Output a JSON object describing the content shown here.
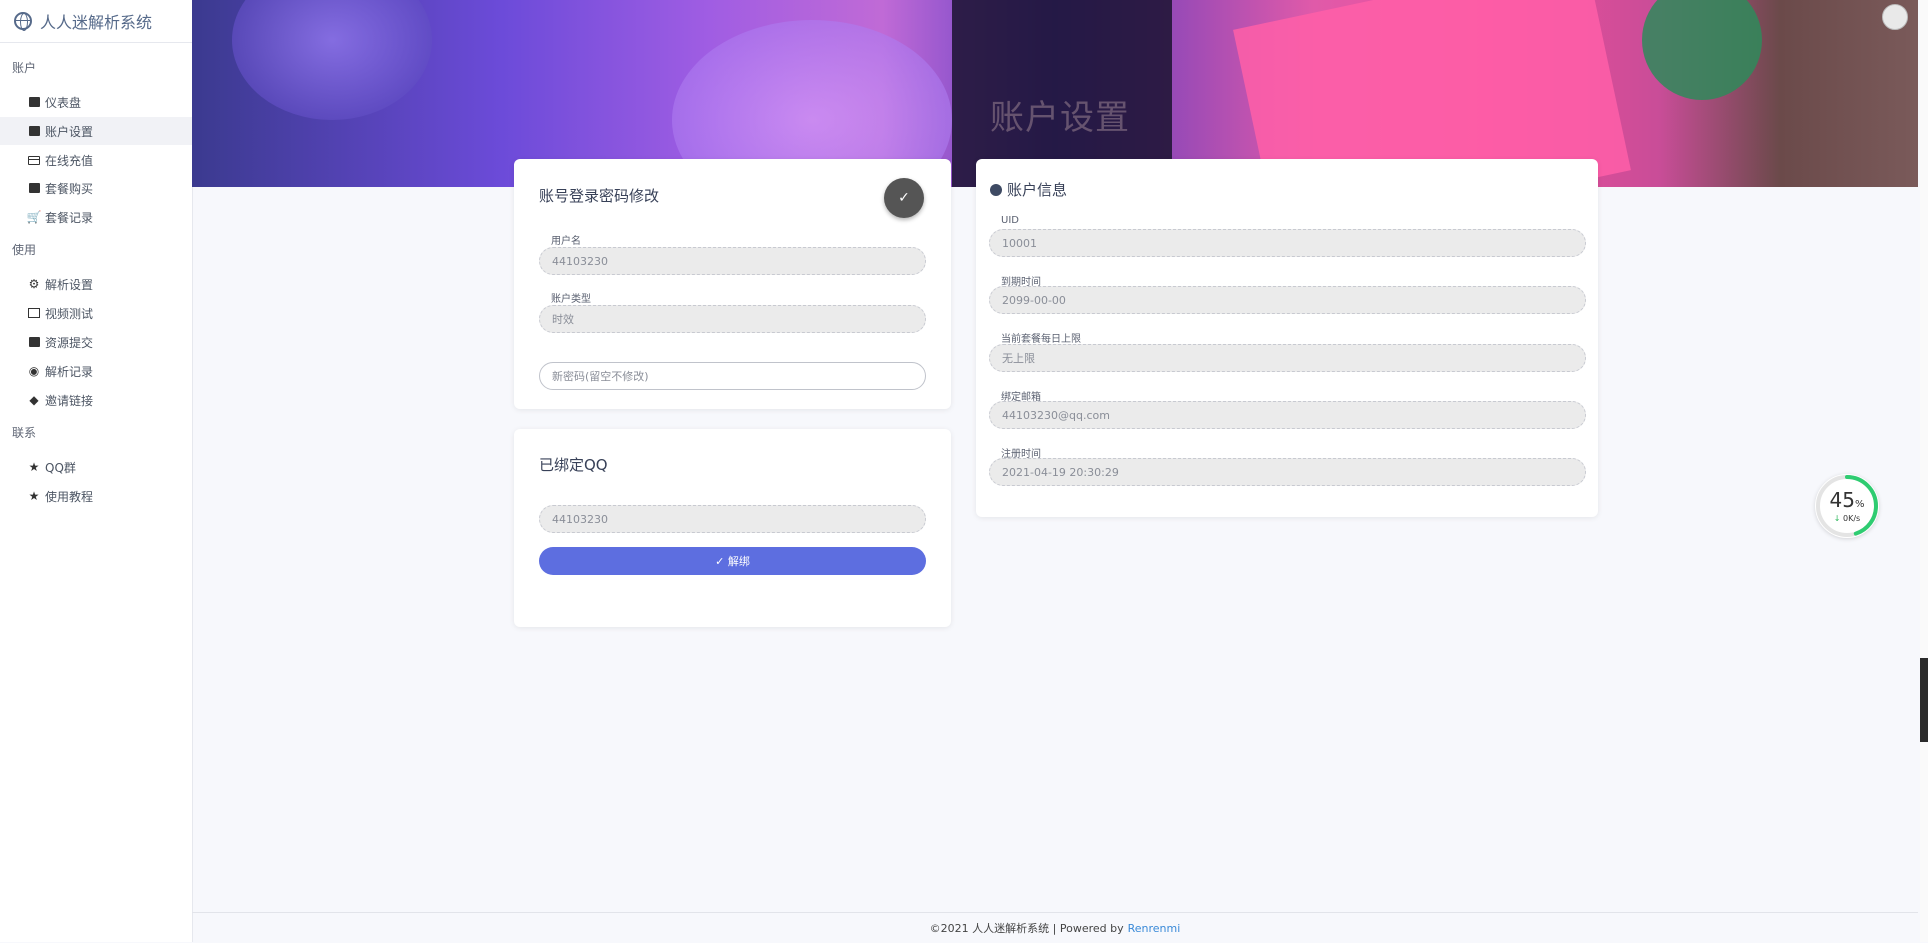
{
  "brand": {
    "title": "人人迷解析系统",
    "icon": "globe-icon"
  },
  "sidebar": {
    "sections": [
      {
        "label": "账户"
      },
      {
        "label": "使用"
      },
      {
        "label": "联系"
      }
    ],
    "items": [
      {
        "label": "仪表盘",
        "icon": "wallet-icon"
      },
      {
        "label": "账户设置",
        "icon": "id-card-icon"
      },
      {
        "label": "在线充值",
        "icon": "credit-card-icon"
      },
      {
        "label": "套餐购买",
        "icon": "shopping-bag-icon"
      },
      {
        "label": "套餐记录",
        "icon": "cart-icon"
      },
      {
        "label": "解析设置",
        "icon": "gear-icon"
      },
      {
        "label": "视频测试",
        "icon": "play-icon"
      },
      {
        "label": "资源提交",
        "icon": "alert-icon"
      },
      {
        "label": "解析记录",
        "icon": "eye-icon"
      },
      {
        "label": "邀请链接",
        "icon": "tag-icon"
      },
      {
        "label": "QQ群",
        "icon": "star-icon"
      },
      {
        "label": "使用教程",
        "icon": "star-icon"
      }
    ]
  },
  "hero": {
    "title": "账户设置"
  },
  "password_card": {
    "title": "账号登录密码修改",
    "username_label": "用户名",
    "username_value": "44103230",
    "type_label": "账户类型",
    "type_value": "时效",
    "new_password_placeholder": "新密码(留空不修改)",
    "confirm_glyph": "✓"
  },
  "qq_card": {
    "title": "已绑定QQ",
    "qq_value": "44103230",
    "unbind_label": "✓ 解绑"
  },
  "account_card": {
    "title": "账户信息",
    "fields": [
      {
        "label": "UID",
        "value": "10001"
      },
      {
        "label": "到期时间",
        "value": "2099-00-00"
      },
      {
        "label": "当前套餐每日上限",
        "value": "无上限"
      },
      {
        "label": "绑定邮箱",
        "value": "44103230@qq.com"
      },
      {
        "label": "注册时间",
        "value": "2021-04-19 20:30:29"
      }
    ]
  },
  "speed_widget": {
    "percent": "45",
    "percent_unit": "%",
    "rate": "0K/s",
    "progress": 0.45,
    "color": "#2ecc71"
  },
  "footer": {
    "text": "©2021 人人迷解析系统 | Powered by",
    "link": "Renrenmi"
  },
  "colors": {
    "accent": "#5d6ee0",
    "link": "#3a8ad8"
  }
}
